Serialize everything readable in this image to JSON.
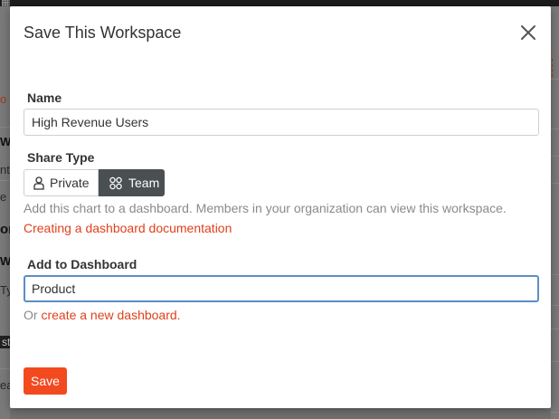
{
  "background": {
    "fragments": [
      "o c",
      "Wh",
      "nt",
      "e",
      "ori",
      "Wh",
      "Ty",
      "st",
      "ea"
    ]
  },
  "modal": {
    "title": "Save This Workspace",
    "close_icon": "close-icon",
    "name": {
      "label": "Name",
      "value": "High Revenue Users"
    },
    "share_type": {
      "label": "Share Type",
      "options": [
        {
          "label": "Private",
          "icon": "person-icon",
          "selected": false
        },
        {
          "label": "Team",
          "icon": "team-icon",
          "selected": true
        }
      ],
      "help_text": "Add this chart to a dashboard. Members in your organization can view this workspace.",
      "doc_link": "Creating a dashboard documentation"
    },
    "dashboard": {
      "label": "Add to Dashboard",
      "value": "Product",
      "or_prefix": "Or ",
      "create_link": "create a new dashboard."
    },
    "save_label": "Save"
  },
  "colors": {
    "accent": "#f3491f",
    "link": "#e0401d",
    "selected_toggle": "#4a4f52",
    "focus_border": "#5b8ec7",
    "overlay": "#707070"
  }
}
